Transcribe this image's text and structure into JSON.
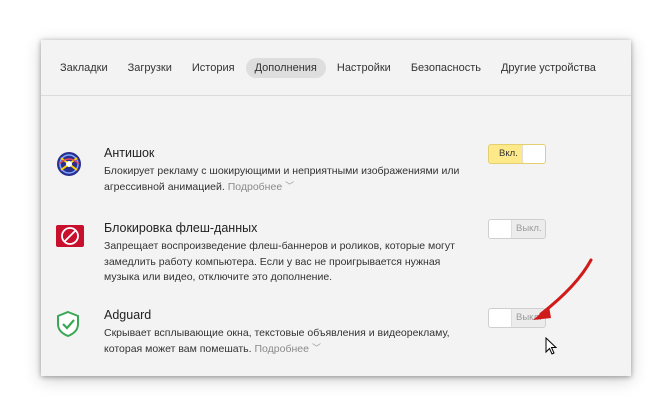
{
  "tabs": [
    {
      "label": "Закладки",
      "active": false
    },
    {
      "label": "Загрузки",
      "active": false
    },
    {
      "label": "История",
      "active": false
    },
    {
      "label": "Дополнения",
      "active": true
    },
    {
      "label": "Настройки",
      "active": false
    },
    {
      "label": "Безопасность",
      "active": false
    },
    {
      "label": "Другие устройства",
      "active": false
    }
  ],
  "extensions": [
    {
      "name": "Антишок",
      "icon": "antishock-icon",
      "description": "Блокирует рекламу с шокирующими и неприятными изображениями или агрессивной анимацией.",
      "more_label": "Подробнее",
      "toggle_label": "Вкл.",
      "enabled": true
    },
    {
      "name": "Блокировка флеш-данных",
      "icon": "flash-block-icon",
      "description": "Запрещает воспроизведение флеш-баннеров и роликов, которые могут замедлить работу компьютера. Если у вас не проигрывается нужная музыка или видео, отключите это дополнение.",
      "more_label": "",
      "toggle_label": "Выкл.",
      "enabled": false
    },
    {
      "name": "Adguard",
      "icon": "adguard-shield-icon",
      "description": "Скрывает всплывающие окна, текстовые объявления и видеорекламу, которая может вам помешать.",
      "more_label": "Подробнее",
      "toggle_label": "Выкл.",
      "enabled": false
    }
  ],
  "colors": {
    "toggle_on": "#fde98a",
    "arrow": "#d11a1a",
    "adguard_green": "#3aa757",
    "flash_red": "#c8102e"
  }
}
